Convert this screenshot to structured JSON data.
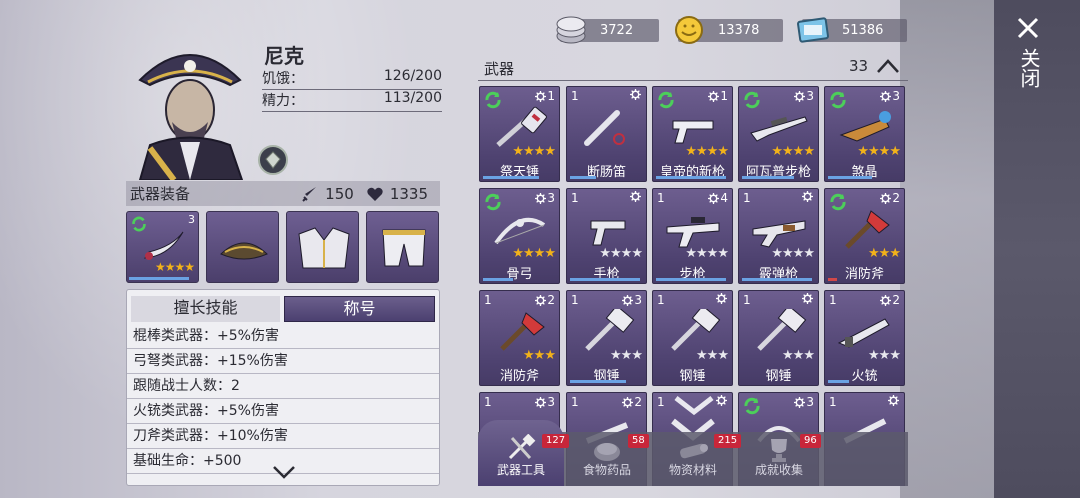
{
  "character": {
    "name": "尼克",
    "hunger_label": "饥饿：",
    "hunger_value": "126/200",
    "energy_label": "精力：",
    "energy_value": "113/200"
  },
  "equipment": {
    "title": "武器装备",
    "attack": "150",
    "health": "1335",
    "slots": [
      {
        "name": "curved-blade",
        "level": "3",
        "stars": 4
      },
      {
        "name": "pirate-hat"
      },
      {
        "name": "pirate-coat"
      },
      {
        "name": "pirate-pants"
      }
    ]
  },
  "skills": {
    "tab_skills": "擅长技能",
    "tab_title": "称号",
    "lines": [
      "棍棒类武器：+5%伤害",
      "弓弩类武器：+15%伤害",
      "跟随战士人数：2",
      "火铳类武器：+5%伤害",
      "刀斧类武器：+10%伤害",
      "基础生命：+500"
    ]
  },
  "currency": {
    "silver": "3722",
    "gold": "13378",
    "tickets": "51386"
  },
  "weapons": {
    "title": "武器",
    "count": "33",
    "items": [
      {
        "count": "",
        "refresh": true,
        "level": "1",
        "stars_on": 4,
        "stars_off": 0,
        "name": "祭天锤",
        "bar": 0.75,
        "bar_color": "blue"
      },
      {
        "count": "1",
        "refresh": false,
        "level": "",
        "stars_on": 0,
        "stars_off": 0,
        "name": "断肠笛",
        "bar": 0.35,
        "bar_color": "blue"
      },
      {
        "count": "",
        "refresh": true,
        "level": "1",
        "stars_on": 4,
        "stars_off": 0,
        "name": "皇帝的新枪",
        "bar": 0.95,
        "bar_color": "blue"
      },
      {
        "count": "",
        "refresh": true,
        "level": "3",
        "stars_on": 4,
        "stars_off": 0,
        "name": "阿瓦普步枪",
        "bar": 0.7,
        "bar_color": "blue"
      },
      {
        "count": "",
        "refresh": true,
        "level": "3",
        "stars_on": 4,
        "stars_off": 0,
        "name": "煞晶",
        "bar": 0.6,
        "bar_color": "blue"
      },
      {
        "count": "",
        "refresh": true,
        "level": "3",
        "stars_on": 4,
        "stars_off": 0,
        "name": "骨弓",
        "bar": 0.4,
        "bar_color": "blue"
      },
      {
        "count": "1",
        "refresh": false,
        "level": "",
        "stars_on": 0,
        "stars_off": 4,
        "name": "手枪",
        "bar": 0.95,
        "bar_color": "blue"
      },
      {
        "count": "1",
        "refresh": false,
        "level": "4",
        "stars_on": 0,
        "stars_off": 4,
        "name": "步枪",
        "bar": 0.95,
        "bar_color": "blue"
      },
      {
        "count": "1",
        "refresh": false,
        "level": "",
        "stars_on": 0,
        "stars_off": 4,
        "name": "霰弹枪",
        "bar": 0.95,
        "bar_color": "blue"
      },
      {
        "count": "",
        "refresh": true,
        "level": "2",
        "stars_on": 3,
        "stars_off": 0,
        "name": "消防斧",
        "bar": 0.12,
        "bar_color": "red"
      },
      {
        "count": "1",
        "refresh": false,
        "level": "2",
        "stars_on": 3,
        "stars_off": 0,
        "name": "消防斧",
        "bar": 0.0,
        "bar_color": "blue"
      },
      {
        "count": "1",
        "refresh": false,
        "level": "3",
        "stars_on": 0,
        "stars_off": 3,
        "name": "钢锤",
        "bar": 0.75,
        "bar_color": "blue"
      },
      {
        "count": "1",
        "refresh": false,
        "level": "",
        "stars_on": 0,
        "stars_off": 3,
        "name": "钢锤",
        "bar": 0.0,
        "bar_color": "blue"
      },
      {
        "count": "1",
        "refresh": false,
        "level": "",
        "stars_on": 0,
        "stars_off": 3,
        "name": "钢锤",
        "bar": 0.0,
        "bar_color": "blue"
      },
      {
        "count": "1",
        "refresh": false,
        "level": "2",
        "stars_on": 0,
        "stars_off": 3,
        "name": "火铳",
        "bar": 0.28,
        "bar_color": "blue"
      },
      {
        "count": "1",
        "refresh": false,
        "level": "3",
        "stars_on": 0,
        "stars_off": 0,
        "name": "",
        "bar": 0,
        "bar_color": "blue"
      },
      {
        "count": "1",
        "refresh": false,
        "level": "2",
        "stars_on": 0,
        "stars_off": 0,
        "name": "",
        "bar": 0,
        "bar_color": "blue"
      },
      {
        "count": "1",
        "refresh": false,
        "level": "",
        "stars_on": 0,
        "stars_off": 0,
        "name": "",
        "bar": 0,
        "bar_color": "blue"
      },
      {
        "count": "",
        "refresh": true,
        "level": "3",
        "stars_on": 0,
        "stars_off": 0,
        "name": "",
        "bar": 0,
        "bar_color": "blue"
      },
      {
        "count": "1",
        "refresh": false,
        "level": "",
        "stars_on": 0,
        "stars_off": 0,
        "name": "",
        "bar": 0,
        "bar_color": "blue"
      }
    ]
  },
  "bottom_tabs": [
    {
      "label": "武器工具",
      "count": "127",
      "active": true
    },
    {
      "label": "食物药品",
      "count": "58",
      "active": false
    },
    {
      "label": "物资材料",
      "count": "215",
      "active": false
    },
    {
      "label": "成就收集",
      "count": "96",
      "active": false
    }
  ],
  "close_label": "关闭",
  "colors": {
    "card_top": "#6d5e8f",
    "card_bottom": "#4e4270",
    "star_gold": "#f2b21a",
    "badge_red": "#c8263a",
    "refresh_green": "#4ccf5a"
  }
}
